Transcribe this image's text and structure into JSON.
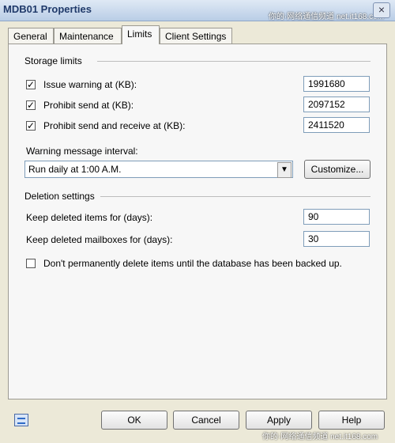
{
  "window": {
    "title": "MDB01 Properties",
    "close": "×",
    "watermark": "你的·网络通信频道 net.it168.com"
  },
  "tabs": [
    {
      "label": "General"
    },
    {
      "label": "Maintenance"
    },
    {
      "label": "Limits"
    },
    {
      "label": "Client Settings"
    }
  ],
  "storage": {
    "title": "Storage limits",
    "items": [
      {
        "label": "Issue warning at (KB):",
        "value": "1991680",
        "checked": true
      },
      {
        "label": "Prohibit send at (KB):",
        "value": "2097152",
        "checked": true
      },
      {
        "label": "Prohibit send and receive at (KB):",
        "value": "2411520",
        "checked": true
      }
    ]
  },
  "warning_interval": {
    "label": "Warning message interval:",
    "value": "Run daily at 1:00 A.M.",
    "customize_label": "Customize..."
  },
  "deletion": {
    "title": "Deletion settings",
    "items": [
      {
        "label": "Keep deleted items for (days):",
        "value": "90"
      },
      {
        "label": "Keep deleted mailboxes for (days):",
        "value": "30"
      }
    ],
    "backup_label": "Don't permanently delete items until the database has been backed up.",
    "backup_checked": false
  },
  "buttons": {
    "ok": "OK",
    "cancel": "Cancel",
    "apply": "Apply",
    "help": "Help"
  },
  "checkmark": "✓",
  "dropdown_arrow": "▼",
  "footer_watermark": "你的·网络通信频道 net.it168.com"
}
